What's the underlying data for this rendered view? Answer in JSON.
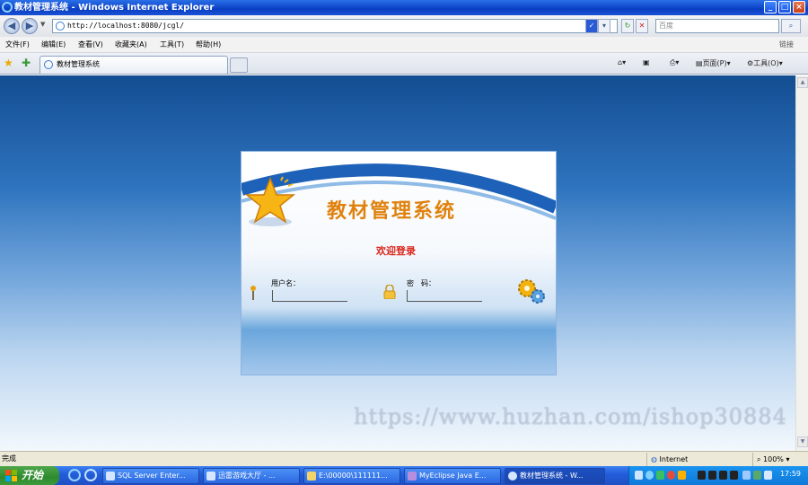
{
  "window": {
    "title": "教材管理系统 - Windows Internet Explorer",
    "minimize": "_",
    "maximize": "□",
    "close": "×"
  },
  "address": {
    "url": "http://localhost:8080/jcgl/",
    "search_placeholder": "百度"
  },
  "menu": {
    "items": [
      "文件(F)",
      "编辑(E)",
      "查看(V)",
      "收藏夹(A)",
      "工具(T)",
      "帮助(H)"
    ],
    "links": "链接"
  },
  "tabs": {
    "active_label": "教材管理系统",
    "page_label": "页面(P)",
    "tools_label": "工具(O)"
  },
  "login": {
    "system_title": "教材管理系统",
    "welcome": "欢迎登录",
    "username_label": "用户名：",
    "password_label": "密　码："
  },
  "watermark": "https://www.huzhan.com/ishop30884",
  "status": {
    "text": "完成",
    "zone": "Internet",
    "zoom": "100%"
  },
  "taskbar": {
    "start": "开始",
    "tasks": [
      "SQL Server Enter...",
      "迅雷游戏大厅 - ...",
      "E:\\00000\\111111...",
      "MyEclipse Java E...",
      "教材管理系统 - W..."
    ],
    "clock": "17:59"
  },
  "colors": {
    "title_orange": "#e0820e",
    "welcome_red": "#d8251a",
    "xp_blue": "#245edb",
    "start_green": "#2e8a2e"
  }
}
